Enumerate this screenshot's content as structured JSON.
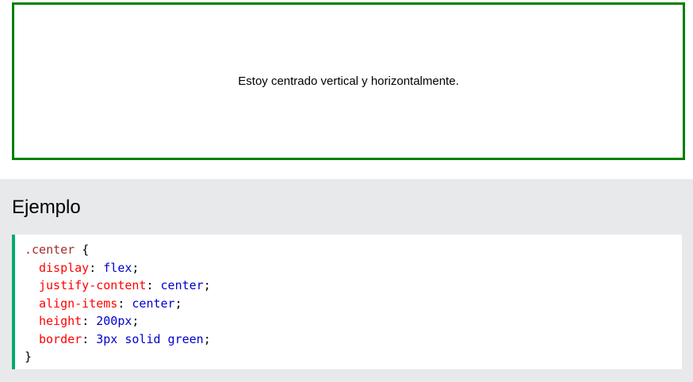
{
  "demo": {
    "text": "Estoy centrado vertical y horizontalmente."
  },
  "example": {
    "title": "Ejemplo",
    "code": {
      "selector": ".center",
      "open_brace": "{",
      "close_brace": "}",
      "declarations": [
        {
          "property": "display",
          "value": "flex"
        },
        {
          "property": "justify-content",
          "value": "center"
        },
        {
          "property": "align-items",
          "value": "center"
        },
        {
          "property": "height",
          "value": "200px"
        },
        {
          "property": "border",
          "value": "3px solid green"
        }
      ]
    }
  },
  "colors": {
    "demo_border": "#008000",
    "panel_background": "#e7e9eb",
    "code_accent": "#04aa6d",
    "selector": "#a52a2a",
    "property": "#ff0000",
    "value": "#0000cd"
  }
}
